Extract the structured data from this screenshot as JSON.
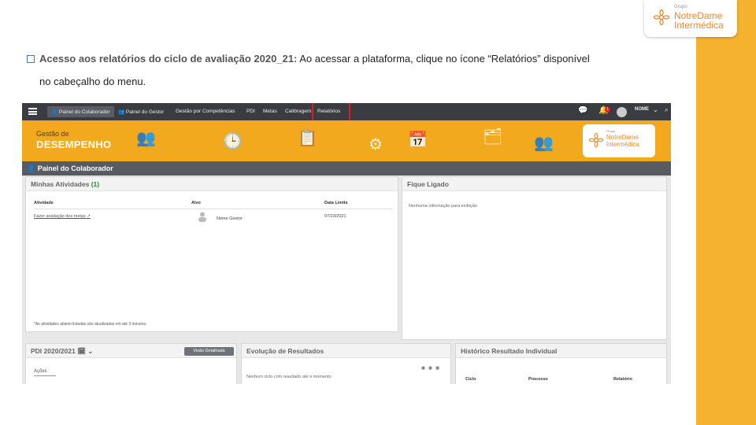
{
  "slide": {
    "logo": {
      "group": "Grupo",
      "line1": "NotreDame",
      "line2": "Intermédica"
    },
    "intro": {
      "bold": "Acesso aos relatórios do ciclo de avaliação 2020_21:",
      "text": " Ao acessar a plataforma, clique no ícone “Relatórios” disponível",
      "line2": "no cabeçalho do menu."
    }
  },
  "app": {
    "nav": {
      "items": [
        "Painel do Colaborador",
        "Painel do Gestor",
        "Gestão por Competências",
        "PDI",
        "Metas",
        "Calibragem",
        "Relatórios"
      ],
      "notification_count": "1",
      "user_label": "NOME"
    },
    "banner": {
      "title_small": "Gestão de",
      "title_big": "DESEMPENHO",
      "brand_group": "Grupo",
      "brand_line1": "NotreDame",
      "brand_line2": "Intermédica"
    },
    "page_title": "Painel do Colaborador",
    "activities": {
      "title": "Minhas Atividades",
      "count": "(1)",
      "columns": [
        "Atividade",
        "Alvo",
        "Data Limite"
      ],
      "row": {
        "activity": "Fazer avaliação dos metas",
        "target": "Nome Gestor",
        "date": "07/23/2021"
      },
      "footer": "*As atividades abaixo listadas são atualizadas em até 3 minutos."
    },
    "stay_connected": {
      "title": "Fique Ligado",
      "message": "Nenhuma informação para exibição"
    },
    "pdi": {
      "title": "PDI 2020/2021",
      "button": "Visão Detalhada",
      "tab": "Ações"
    },
    "results": {
      "title": "Evolução de Resultados",
      "message": "Nenhum ciclo com resultado até o momento"
    },
    "history": {
      "title": "Histórico Resultado Individual",
      "columns": [
        "Ciclo",
        "Processo",
        "Relatório"
      ]
    }
  },
  "colors": {
    "accent_orange": "#f4b22e",
    "banner_orange": "#f2a91d",
    "highlight_red": "#e0192b",
    "nav_dark": "#3a3c41"
  }
}
